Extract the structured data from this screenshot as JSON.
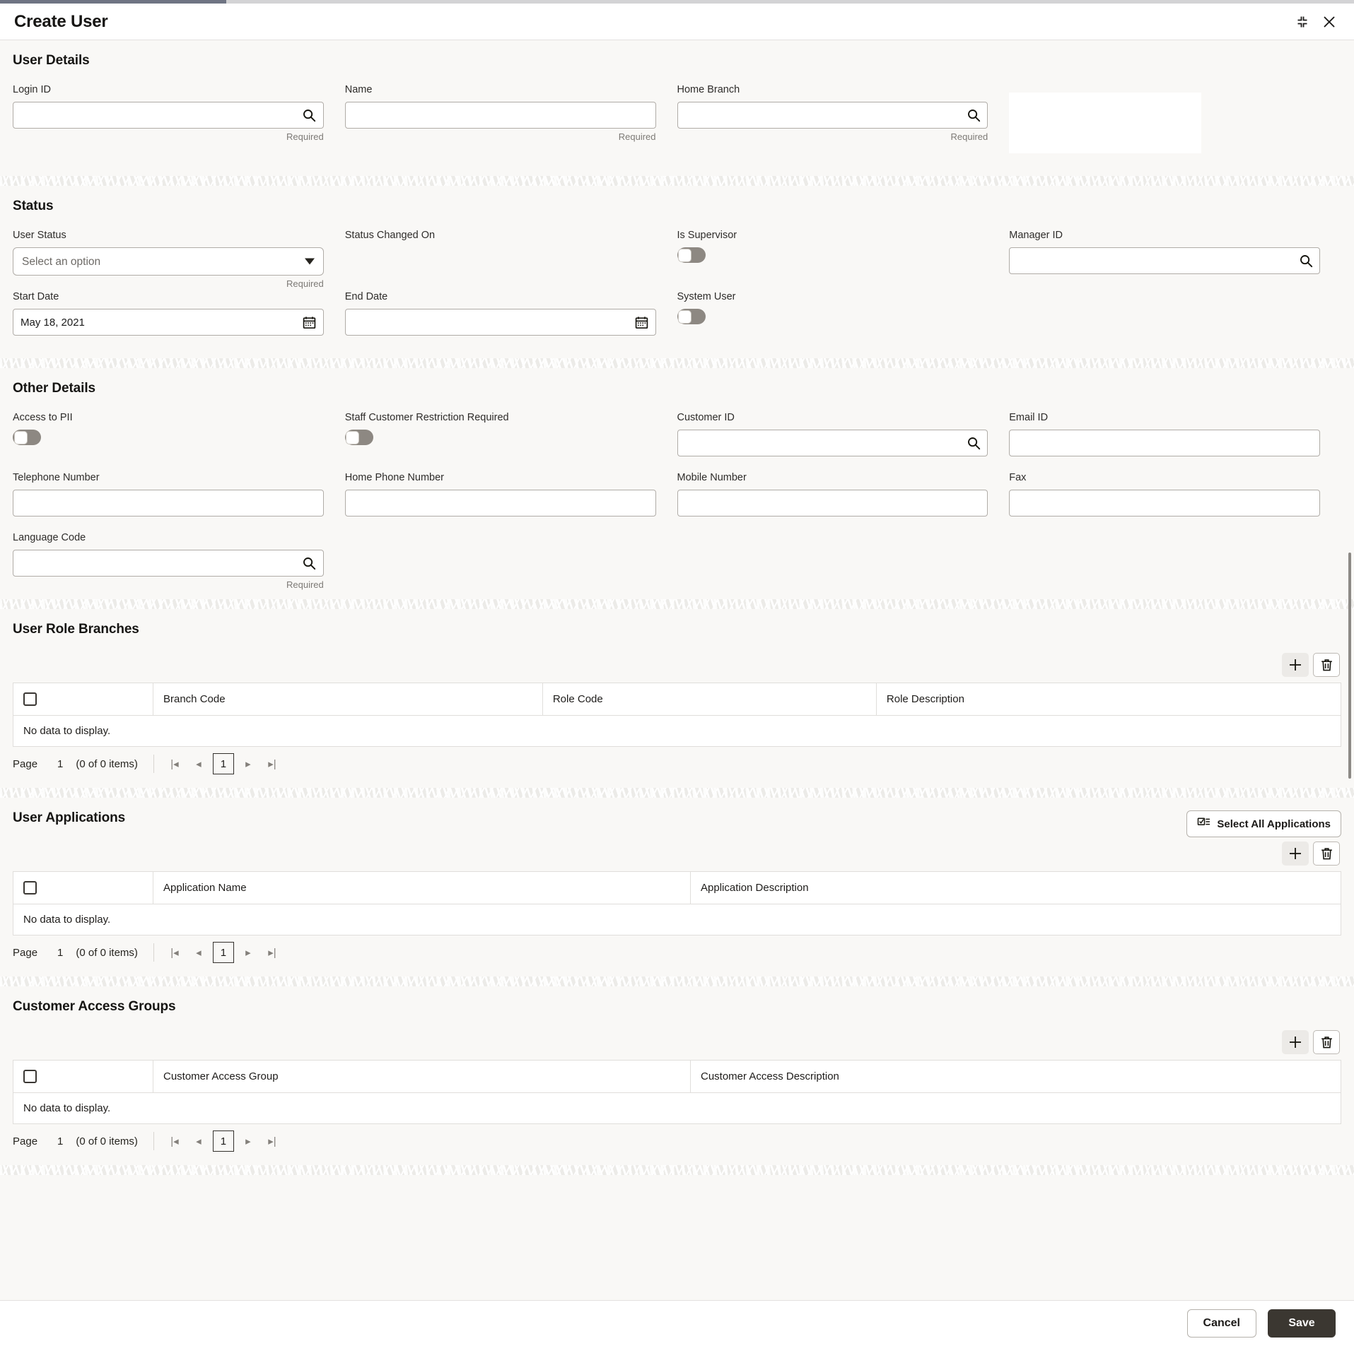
{
  "window": {
    "title": "Create User",
    "minimize_icon": "collapse-icon",
    "close_icon": "close-icon"
  },
  "sections": {
    "user_details": {
      "title": "User Details",
      "fields": {
        "login_id": {
          "label": "Login ID",
          "value": "",
          "placeholder": "",
          "helper": "Required",
          "icon": "search-icon"
        },
        "name": {
          "label": "Name",
          "value": "",
          "placeholder": "",
          "helper": "Required",
          "icon": ""
        },
        "home_branch": {
          "label": "Home Branch",
          "value": "",
          "placeholder": "",
          "helper": "Required",
          "icon": "search-icon"
        }
      }
    },
    "status": {
      "title": "Status",
      "fields": {
        "user_status": {
          "label": "User Status",
          "selected": "Select an option",
          "options": [
            "Select an option"
          ],
          "helper": "Required"
        },
        "status_changed_on": {
          "label": "Status Changed On",
          "value": ""
        },
        "is_supervisor": {
          "label": "Is Supervisor",
          "state": "off"
        },
        "manager_id": {
          "label": "Manager ID",
          "value": "",
          "icon": "search-icon"
        },
        "start_date": {
          "label": "Start Date",
          "value": "May 18, 2021",
          "icon": "calendar-icon"
        },
        "end_date": {
          "label": "End Date",
          "value": "",
          "icon": "calendar-icon"
        },
        "system_user": {
          "label": "System User",
          "state": "off"
        }
      }
    },
    "other_details": {
      "title": "Other Details",
      "fields": {
        "access_to_pii": {
          "label": "Access to PII",
          "state": "off"
        },
        "staff_customer": {
          "label": "Staff Customer Restriction Required",
          "state": "off"
        },
        "customer_id": {
          "label": "Customer ID",
          "value": "",
          "icon": "search-icon"
        },
        "email_id": {
          "label": "Email ID",
          "value": ""
        },
        "telephone": {
          "label": "Telephone Number",
          "value": ""
        },
        "home_phone": {
          "label": "Home Phone Number",
          "value": ""
        },
        "mobile": {
          "label": "Mobile Number",
          "value": ""
        },
        "fax": {
          "label": "Fax",
          "value": ""
        },
        "language_code": {
          "label": "Language Code",
          "value": "",
          "helper": "Required",
          "icon": "search-icon"
        }
      }
    },
    "user_role_branches": {
      "title": "User Role Branches",
      "add_icon": "plus-icon",
      "delete_icon": "trash-icon",
      "columns": [
        "",
        "Branch Code",
        "Role Code",
        "Role Description"
      ],
      "rows": [],
      "empty_text": "No data to display.",
      "pager": {
        "page_label": "Page",
        "page_number": "1",
        "count_text": "(0 of 0 items)",
        "current": "1",
        "first_icon": "first-page-icon",
        "prev_icon": "prev-page-icon",
        "next_icon": "next-page-icon",
        "last_icon": "last-page-icon"
      }
    },
    "user_applications": {
      "title": "User Applications",
      "select_all_label": "Select All Applications",
      "select_all_icon": "checklist-icon",
      "add_icon": "plus-icon",
      "delete_icon": "trash-icon",
      "columns": [
        "",
        "Application Name",
        "Application Description"
      ],
      "rows": [],
      "empty_text": "No data to display.",
      "pager": {
        "page_label": "Page",
        "page_number": "1",
        "count_text": "(0 of 0 items)",
        "current": "1"
      }
    },
    "customer_access_groups": {
      "title": "Customer Access Groups",
      "add_icon": "plus-icon",
      "delete_icon": "trash-icon",
      "columns": [
        "",
        "Customer Access Group",
        "Customer Access Description"
      ],
      "rows": [],
      "empty_text": "No data to display.",
      "pager": {
        "page_label": "Page",
        "page_number": "1",
        "count_text": "(0 of 0 items)",
        "current": "1"
      }
    }
  },
  "footer": {
    "cancel_label": "Cancel",
    "save_label": "Save"
  },
  "colors": {
    "page_bg": "#f9f8f6",
    "accent_bar": "#6f7483",
    "save_bg": "#3b3731",
    "toggle_off": "#8d8882"
  }
}
